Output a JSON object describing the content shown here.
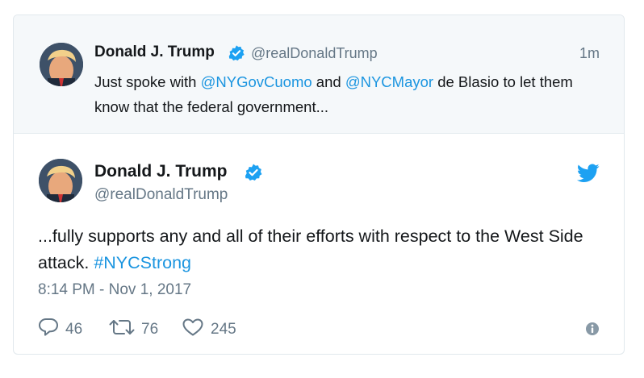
{
  "parent_tweet": {
    "display_name": "Donald J. Trump",
    "handle": "@realDonaldTrump",
    "time": "1m",
    "text_1": "Just spoke with ",
    "mention_1": "@NYGovCuomo",
    "text_2": " and ",
    "mention_2": "@NYCMayor",
    "text_3": " de Blasio to let them know that the federal government..."
  },
  "main_tweet": {
    "display_name": "Donald J. Trump",
    "handle": "@realDonaldTrump",
    "text": "...fully supports any and all of their efforts with respect to the West Side attack. ",
    "hashtag": "#NYCStrong",
    "timestamp": "8:14 PM - Nov 1, 2017",
    "actions": {
      "replies": "46",
      "retweets": "76",
      "likes": "245"
    }
  },
  "icons": {
    "verified": "verified-badge-icon",
    "twitter": "twitter-bird-icon",
    "reply": "reply-icon",
    "retweet": "retweet-icon",
    "like": "heart-icon",
    "info": "info-icon"
  },
  "colors": {
    "accent": "#1b95e0",
    "verified": "#1da1f2",
    "secondary_text": "#657786",
    "parent_background": "#f5f8fa",
    "border": "#e1e8ed"
  }
}
